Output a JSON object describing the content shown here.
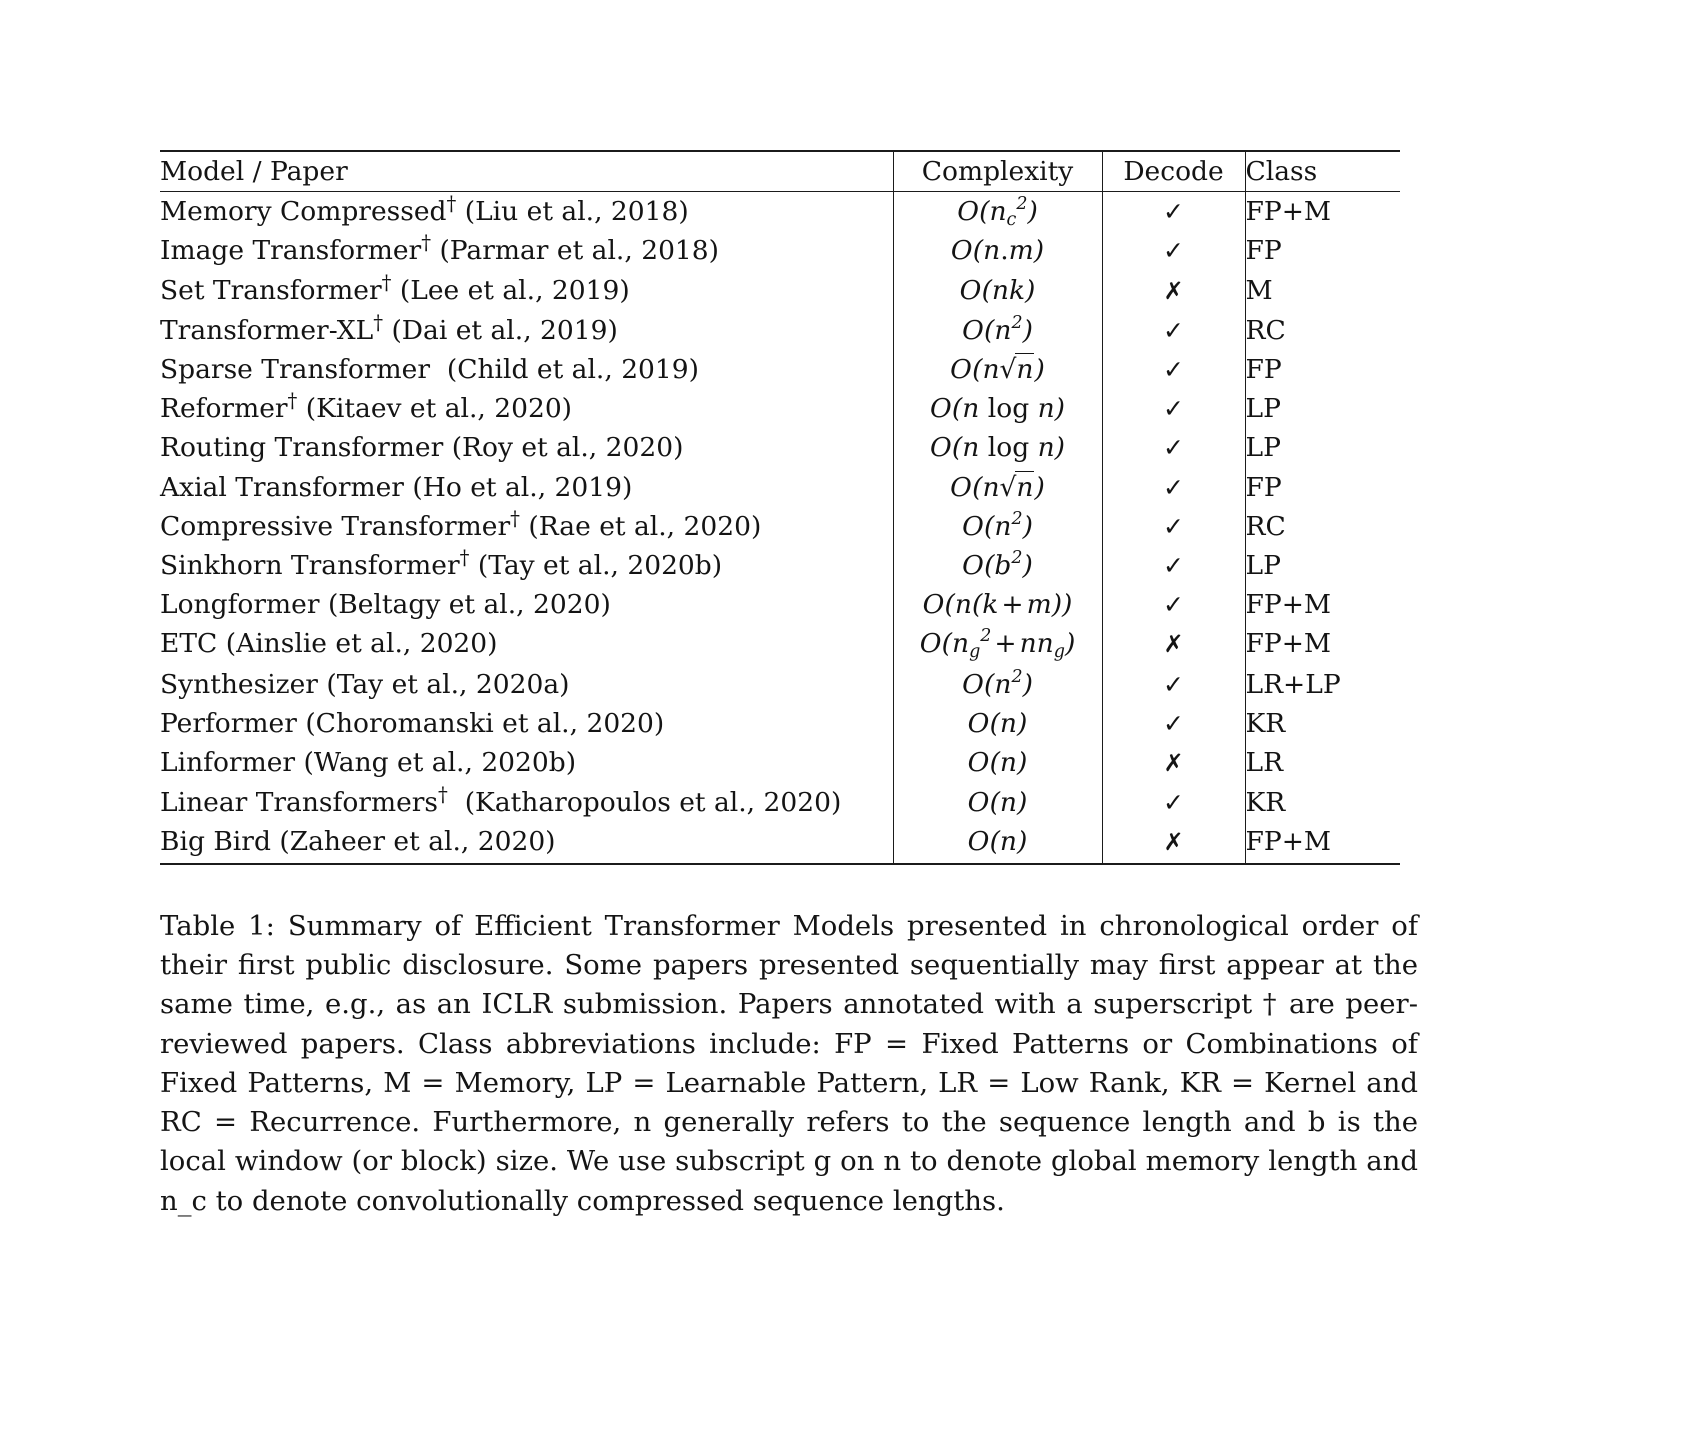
{
  "table": {
    "columns": [
      "Model / Paper",
      "Complexity",
      "Decode",
      "Class"
    ],
    "rows": [
      {
        "model_name": "Memory Compressed",
        "dagger": "†",
        "citation": "(Liu et al., 2018)",
        "complexity": "O(n_c^2)",
        "decode": "✓",
        "class": "FP+M"
      },
      {
        "model_name": "Image Transformer",
        "dagger": "†",
        "citation": "(Parmar et al., 2018)",
        "complexity": "O(n.m)",
        "decode": "✓",
        "class": "FP"
      },
      {
        "model_name": "Set Transformer",
        "dagger": "†",
        "citation": "(Lee et al., 2019)",
        "complexity": "O(nk)",
        "decode": "✗",
        "class": "M"
      },
      {
        "model_name": "Transformer-XL",
        "dagger": "†",
        "citation": "(Dai et al., 2019)",
        "complexity": "O(n^2)",
        "decode": "✓",
        "class": "RC"
      },
      {
        "model_name": "Sparse Transformer",
        "dagger": "",
        "citation": "(Child et al., 2019)",
        "complexity": "O(n√n)",
        "decode": "✓",
        "class": "FP"
      },
      {
        "model_name": "Reformer",
        "dagger": "†",
        "citation": "(Kitaev et al., 2020)",
        "complexity": "O(n log n)",
        "decode": "✓",
        "class": "LP"
      },
      {
        "model_name": "Routing Transformer",
        "dagger": "",
        "citation": "(Roy et al., 2020)",
        "complexity": "O(n log n)",
        "decode": "✓",
        "class": "LP"
      },
      {
        "model_name": "Axial Transformer",
        "dagger": "",
        "citation": "(Ho et al., 2019)",
        "complexity": "O(n√n)",
        "decode": "✓",
        "class": "FP"
      },
      {
        "model_name": "Compressive Transformer",
        "dagger": "†",
        "citation": "(Rae et al., 2020)",
        "complexity": "O(n^2)",
        "decode": "✓",
        "class": "RC"
      },
      {
        "model_name": "Sinkhorn Transformer",
        "dagger": "†",
        "citation": "(Tay et al., 2020b)",
        "complexity": "O(b^2)",
        "decode": "✓",
        "class": "LP"
      },
      {
        "model_name": "Longformer",
        "dagger": "",
        "citation": "(Beltagy et al., 2020)",
        "complexity": "O(n(k + m))",
        "decode": "✓",
        "class": "FP+M"
      },
      {
        "model_name": "ETC",
        "dagger": "",
        "citation": "(Ainslie et al., 2020)",
        "complexity": "O(n_g^2 + nn_g)",
        "decode": "✗",
        "class": "FP+M"
      },
      {
        "model_name": "Synthesizer",
        "dagger": "",
        "citation": "(Tay et al., 2020a)",
        "complexity": "O(n^2)",
        "decode": "✓",
        "class": "LR+LP"
      },
      {
        "model_name": "Performer",
        "dagger": "",
        "citation": "(Choromanski et al., 2020)",
        "complexity": "O(n)",
        "decode": "✓",
        "class": "KR"
      },
      {
        "model_name": "Linformer",
        "dagger": "",
        "citation": "(Wang et al., 2020b)",
        "complexity": "O(n)",
        "decode": "✗",
        "class": "LR"
      },
      {
        "model_name": "Linear Transformers",
        "dagger": "†",
        "citation": "(Katharopoulos et al., 2020)",
        "complexity": "O(n)",
        "decode": "✓",
        "class": "KR"
      },
      {
        "model_name": "Big Bird",
        "dagger": "",
        "citation": "(Zaheer et al., 2020)",
        "complexity": "O(n)",
        "decode": "✗",
        "class": "FP+M"
      }
    ]
  },
  "caption": {
    "label": "Table 1:",
    "text": "Summary of Efficient Transformer Models presented in chronological order of their first public disclosure. Some papers presented sequentially may first appear at the same time, e.g., as an ICLR submission. Papers annotated with a superscript † are peer-reviewed papers. Class abbreviations include: FP = Fixed Patterns or Combinations of Fixed Patterns, M = Memory, LP = Learnable Pattern, LR = Low Rank, KR = Kernel and RC = Recurrence. Furthermore, n generally refers to the sequence length and b is the local window (or block) size. We use subscript g on n to denote global memory length and n_c to denote convolutionally compressed sequence lengths."
  },
  "chart_data": {
    "type": "table",
    "title": "Summary of Efficient Transformer Models",
    "columns": [
      "Model / Paper",
      "Complexity",
      "Decode",
      "Class"
    ],
    "rows": [
      [
        "Memory Compressed† (Liu et al., 2018)",
        "O(n_c^2)",
        "yes",
        "FP+M"
      ],
      [
        "Image Transformer† (Parmar et al., 2018)",
        "O(n.m)",
        "yes",
        "FP"
      ],
      [
        "Set Transformer† (Lee et al., 2019)",
        "O(nk)",
        "no",
        "M"
      ],
      [
        "Transformer-XL† (Dai et al., 2019)",
        "O(n^2)",
        "yes",
        "RC"
      ],
      [
        "Sparse Transformer (Child et al., 2019)",
        "O(n sqrt(n))",
        "yes",
        "FP"
      ],
      [
        "Reformer† (Kitaev et al., 2020)",
        "O(n log n)",
        "yes",
        "LP"
      ],
      [
        "Routing Transformer (Roy et al., 2020)",
        "O(n log n)",
        "yes",
        "LP"
      ],
      [
        "Axial Transformer (Ho et al., 2019)",
        "O(n sqrt(n))",
        "yes",
        "FP"
      ],
      [
        "Compressive Transformer† (Rae et al., 2020)",
        "O(n^2)",
        "yes",
        "RC"
      ],
      [
        "Sinkhorn Transformer† (Tay et al., 2020b)",
        "O(b^2)",
        "yes",
        "LP"
      ],
      [
        "Longformer (Beltagy et al., 2020)",
        "O(n(k + m))",
        "yes",
        "FP+M"
      ],
      [
        "ETC (Ainslie et al., 2020)",
        "O(n_g^2 + n n_g)",
        "no",
        "FP+M"
      ],
      [
        "Synthesizer (Tay et al., 2020a)",
        "O(n^2)",
        "yes",
        "LR+LP"
      ],
      [
        "Performer (Choromanski et al., 2020)",
        "O(n)",
        "yes",
        "KR"
      ],
      [
        "Linformer (Wang et al., 2020b)",
        "O(n)",
        "no",
        "LR"
      ],
      [
        "Linear Transformers† (Katharopoulos et al., 2020)",
        "O(n)",
        "yes",
        "KR"
      ],
      [
        "Big Bird (Zaheer et al., 2020)",
        "O(n)",
        "no",
        "FP+M"
      ]
    ]
  }
}
